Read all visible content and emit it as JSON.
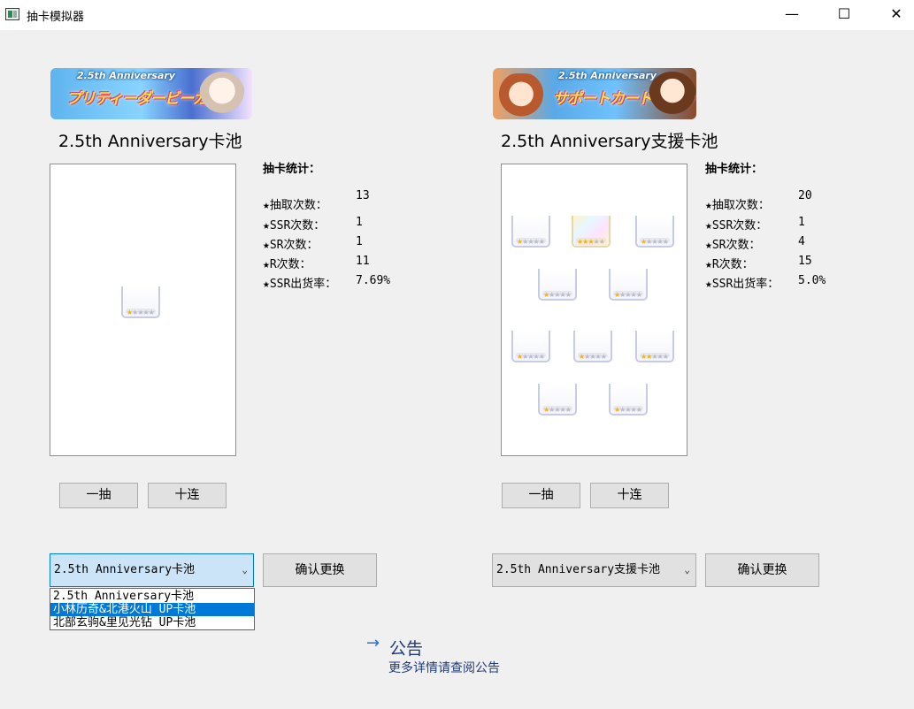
{
  "window": {
    "title": "抽卡模拟器",
    "minimize_glyph": "—",
    "maximize_glyph": "☐",
    "close_glyph": "✕"
  },
  "left_pool": {
    "banner": {
      "anniv": "2.5th Anniversary",
      "text": "プリティーダービーガチャ"
    },
    "title": "2.5th Anniversary卡池",
    "stats": {
      "heading": "抽卡统计：",
      "draws_label": "★抽取次数：",
      "draws_value": "13",
      "ssr_label": "★SSR次数：",
      "ssr_value": "1",
      "sr_label": "★SR次数：",
      "sr_value": "1",
      "r_label": "★R次数：",
      "r_value": "11",
      "rate_label": "★SSR出货率：",
      "rate_value": "7.69%"
    },
    "single_button": "一抽",
    "ten_button": "十连",
    "combo_value": "2.5th Anniversary卡池",
    "dropdown_options": [
      "2.5th Anniversary卡池",
      "小林历奇&北港火山 UP卡池",
      "北部玄驹&里见光钻 UP卡池"
    ],
    "dropdown_selected_index": 1,
    "confirm_button": "确认更换",
    "cards": [
      {
        "rarity": 1
      }
    ]
  },
  "right_pool": {
    "banner": {
      "anniv": "2.5th Anniversary",
      "text": "サポートカードガチャ"
    },
    "title": "2.5th Anniversary支援卡池",
    "stats": {
      "heading": "抽卡统计：",
      "draws_label": "★抽取次数：",
      "draws_value": "20",
      "ssr_label": "★SSR次数：",
      "ssr_value": "1",
      "sr_label": "★SR次数：",
      "sr_value": "4",
      "r_label": "★R次数：",
      "r_value": "15",
      "rate_label": "★SSR出货率：",
      "rate_value": "5.0%"
    },
    "single_button": "一抽",
    "ten_button": "十连",
    "combo_value": "2.5th Anniversary支援卡池",
    "confirm_button": "确认更换",
    "cards": [
      {
        "rarity": 1
      },
      {
        "rarity": 3
      },
      {
        "rarity": 1
      },
      {
        "rarity": 1
      },
      {
        "rarity": 1
      },
      {
        "rarity": 1
      },
      {
        "rarity": 1
      },
      {
        "rarity": 2
      },
      {
        "rarity": 1
      },
      {
        "rarity": 1
      }
    ]
  },
  "notice": {
    "arrow": "→",
    "title": "公告",
    "subtitle": "更多详情请查阅公告"
  },
  "icons": {
    "dropdown_arrow": "chevron-down-icon",
    "star": "★",
    "star_empty": "☆"
  },
  "colors": {
    "selection": "#0078d7",
    "notice_text": "#1f3a78",
    "notice_arrow": "#1e73d4"
  }
}
